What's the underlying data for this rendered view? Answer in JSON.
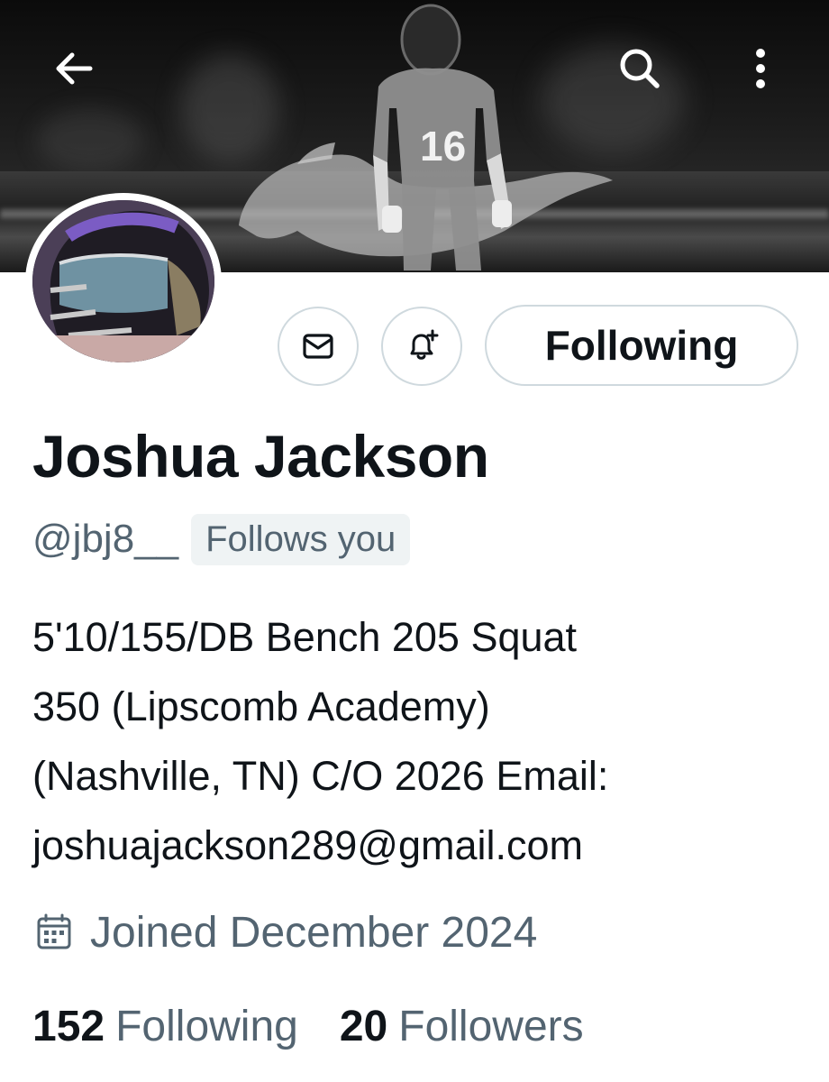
{
  "header": {
    "icons": {
      "back": "arrow-left-icon",
      "search": "search-icon",
      "more": "more-vertical-icon"
    },
    "banner_number": "16"
  },
  "actions": {
    "message_icon": "envelope-icon",
    "notify_icon": "bell-plus-icon",
    "following_label": "Following"
  },
  "profile": {
    "name": "Joshua Jackson",
    "handle": "@jbj8__",
    "follows_you": "Follows you",
    "bio_lines": [
      "5'10/155/DB Bench 205 Squat",
      "350 (Lipscomb Academy)",
      "(Nashville, TN) C/O 2026 Email:",
      "joshuajackson289@gmail.com"
    ],
    "joined": "Joined December 2024",
    "following_count": "152",
    "following_label": "Following",
    "followers_count": "20",
    "followers_label": "Followers"
  },
  "colors": {
    "text_primary": "#0f1419",
    "text_secondary": "#536471",
    "border": "#cfd9de",
    "badge_bg": "#eff3f4"
  }
}
